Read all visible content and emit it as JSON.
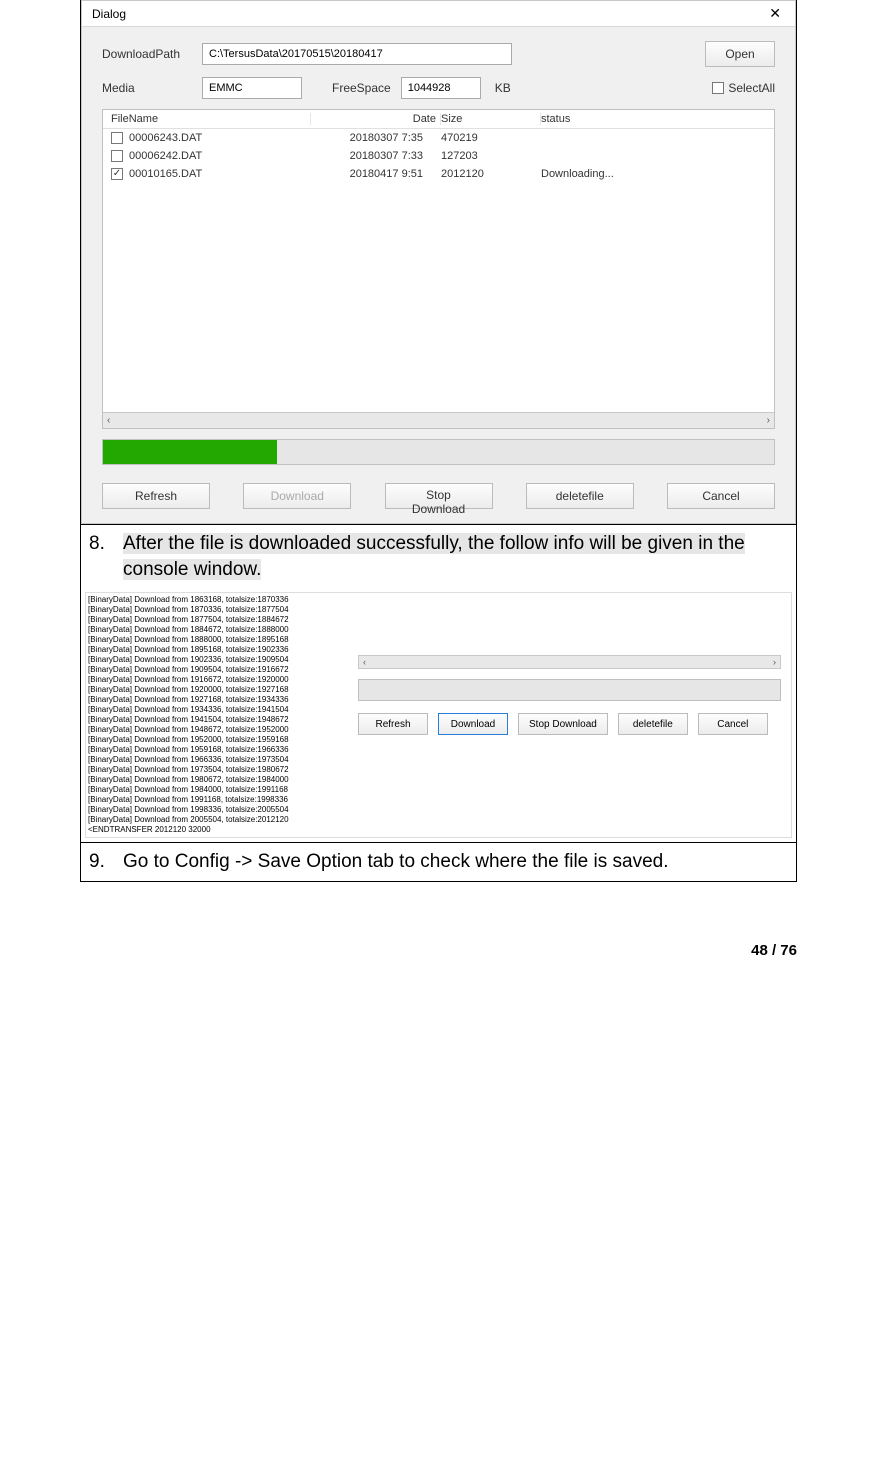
{
  "dialog": {
    "title": "Dialog",
    "labels": {
      "downloadPath": "DownloadPath",
      "media": "Media",
      "freeSpace": "FreeSpace",
      "kb": "KB",
      "selectAll": "SelectAll",
      "open": "Open"
    },
    "values": {
      "path": "C:\\TersusData\\20170515\\20180417",
      "media": "EMMC",
      "freeSpace": "1044928"
    },
    "columns": {
      "name": "FileName",
      "date": "Date",
      "size": "Size",
      "status": "status"
    },
    "files": [
      {
        "checked": false,
        "name": "00006243.DAT",
        "date": "20180307 7:35",
        "size": "470219",
        "status": ""
      },
      {
        "checked": false,
        "name": "00006242.DAT",
        "date": "20180307 7:33",
        "size": "127203",
        "status": ""
      },
      {
        "checked": true,
        "name": "00010165.DAT",
        "date": "20180417 9:51",
        "size": "2012120",
        "status": "Downloading..."
      }
    ],
    "buttons": {
      "refresh": "Refresh",
      "download": "Download",
      "stop": "Stop Download",
      "delete": "deletefile",
      "cancel": "Cancel"
    }
  },
  "step8": {
    "num": "8.",
    "text": "After the file is downloaded successfully, the follow info will be given in the console window."
  },
  "console": {
    "lines": "[BinaryData] Download from 1863168, totalsize:1870336\n[BinaryData] Download from 1870336, totalsize:1877504\n[BinaryData] Download from 1877504, totalsize:1884672\n[BinaryData] Download from 1884672, totalsize:1888000\n[BinaryData] Download from 1888000, totalsize:1895168\n[BinaryData] Download from 1895168, totalsize:1902336\n[BinaryData] Download from 1902336, totalsize:1909504\n[BinaryData] Download from 1909504, totalsize:1916672\n[BinaryData] Download from 1916672, totalsize:1920000\n[BinaryData] Download from 1920000, totalsize:1927168\n[BinaryData] Download from 1927168, totalsize:1934336\n[BinaryData] Download from 1934336, totalsize:1941504\n[BinaryData] Download from 1941504, totalsize:1948672\n[BinaryData] Download from 1948672, totalsize:1952000\n[BinaryData] Download from 1952000, totalsize:1959168\n[BinaryData] Download from 1959168, totalsize:1966336\n[BinaryData] Download from 1966336, totalsize:1973504\n[BinaryData] Download from 1973504, totalsize:1980672\n[BinaryData] Download from 1980672, totalsize:1984000\n[BinaryData] Download from 1984000, totalsize:1991168\n[BinaryData] Download from 1991168, totalsize:1998336\n[BinaryData] Download from 1998336, totalsize:2005504\n[BinaryData] Download from 2005504, totalsize:2012120\n<ENDTRANSFER 2012120 32000",
    "buttons": {
      "refresh": "Refresh",
      "download": "Download",
      "stop": "Stop Download",
      "delete": "deletefile",
      "cancel": "Cancel"
    }
  },
  "step9": {
    "num": "9.",
    "text": "Go to Config -> Save Option tab to check where the file is saved."
  },
  "pageNumber": "48 / 76"
}
